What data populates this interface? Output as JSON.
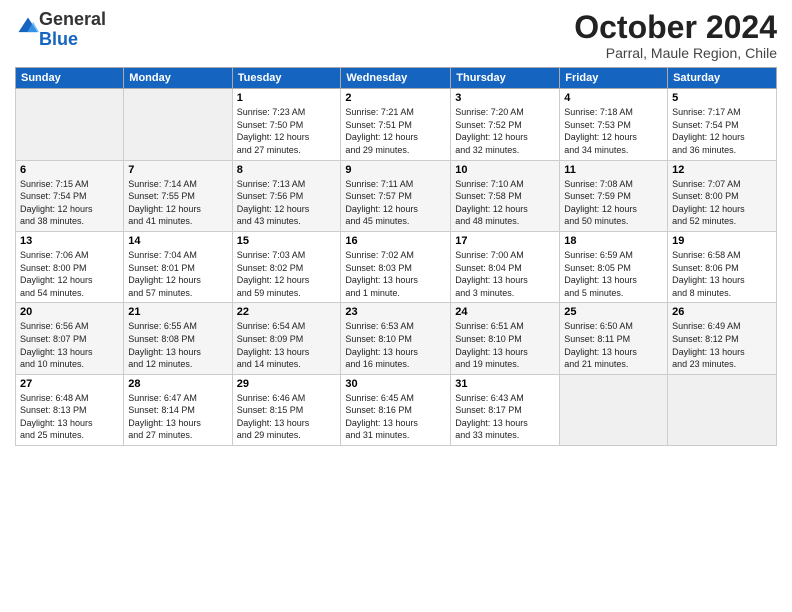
{
  "logo": {
    "general": "General",
    "blue": "Blue"
  },
  "header": {
    "month": "October 2024",
    "subtitle": "Parral, Maule Region, Chile"
  },
  "weekdays": [
    "Sunday",
    "Monday",
    "Tuesday",
    "Wednesday",
    "Thursday",
    "Friday",
    "Saturday"
  ],
  "weeks": [
    [
      {
        "day": "",
        "detail": ""
      },
      {
        "day": "",
        "detail": ""
      },
      {
        "day": "1",
        "detail": "Sunrise: 7:23 AM\nSunset: 7:50 PM\nDaylight: 12 hours\nand 27 minutes."
      },
      {
        "day": "2",
        "detail": "Sunrise: 7:21 AM\nSunset: 7:51 PM\nDaylight: 12 hours\nand 29 minutes."
      },
      {
        "day": "3",
        "detail": "Sunrise: 7:20 AM\nSunset: 7:52 PM\nDaylight: 12 hours\nand 32 minutes."
      },
      {
        "day": "4",
        "detail": "Sunrise: 7:18 AM\nSunset: 7:53 PM\nDaylight: 12 hours\nand 34 minutes."
      },
      {
        "day": "5",
        "detail": "Sunrise: 7:17 AM\nSunset: 7:54 PM\nDaylight: 12 hours\nand 36 minutes."
      }
    ],
    [
      {
        "day": "6",
        "detail": "Sunrise: 7:15 AM\nSunset: 7:54 PM\nDaylight: 12 hours\nand 38 minutes."
      },
      {
        "day": "7",
        "detail": "Sunrise: 7:14 AM\nSunset: 7:55 PM\nDaylight: 12 hours\nand 41 minutes."
      },
      {
        "day": "8",
        "detail": "Sunrise: 7:13 AM\nSunset: 7:56 PM\nDaylight: 12 hours\nand 43 minutes."
      },
      {
        "day": "9",
        "detail": "Sunrise: 7:11 AM\nSunset: 7:57 PM\nDaylight: 12 hours\nand 45 minutes."
      },
      {
        "day": "10",
        "detail": "Sunrise: 7:10 AM\nSunset: 7:58 PM\nDaylight: 12 hours\nand 48 minutes."
      },
      {
        "day": "11",
        "detail": "Sunrise: 7:08 AM\nSunset: 7:59 PM\nDaylight: 12 hours\nand 50 minutes."
      },
      {
        "day": "12",
        "detail": "Sunrise: 7:07 AM\nSunset: 8:00 PM\nDaylight: 12 hours\nand 52 minutes."
      }
    ],
    [
      {
        "day": "13",
        "detail": "Sunrise: 7:06 AM\nSunset: 8:00 PM\nDaylight: 12 hours\nand 54 minutes."
      },
      {
        "day": "14",
        "detail": "Sunrise: 7:04 AM\nSunset: 8:01 PM\nDaylight: 12 hours\nand 57 minutes."
      },
      {
        "day": "15",
        "detail": "Sunrise: 7:03 AM\nSunset: 8:02 PM\nDaylight: 12 hours\nand 59 minutes."
      },
      {
        "day": "16",
        "detail": "Sunrise: 7:02 AM\nSunset: 8:03 PM\nDaylight: 13 hours\nand 1 minute."
      },
      {
        "day": "17",
        "detail": "Sunrise: 7:00 AM\nSunset: 8:04 PM\nDaylight: 13 hours\nand 3 minutes."
      },
      {
        "day": "18",
        "detail": "Sunrise: 6:59 AM\nSunset: 8:05 PM\nDaylight: 13 hours\nand 5 minutes."
      },
      {
        "day": "19",
        "detail": "Sunrise: 6:58 AM\nSunset: 8:06 PM\nDaylight: 13 hours\nand 8 minutes."
      }
    ],
    [
      {
        "day": "20",
        "detail": "Sunrise: 6:56 AM\nSunset: 8:07 PM\nDaylight: 13 hours\nand 10 minutes."
      },
      {
        "day": "21",
        "detail": "Sunrise: 6:55 AM\nSunset: 8:08 PM\nDaylight: 13 hours\nand 12 minutes."
      },
      {
        "day": "22",
        "detail": "Sunrise: 6:54 AM\nSunset: 8:09 PM\nDaylight: 13 hours\nand 14 minutes."
      },
      {
        "day": "23",
        "detail": "Sunrise: 6:53 AM\nSunset: 8:10 PM\nDaylight: 13 hours\nand 16 minutes."
      },
      {
        "day": "24",
        "detail": "Sunrise: 6:51 AM\nSunset: 8:10 PM\nDaylight: 13 hours\nand 19 minutes."
      },
      {
        "day": "25",
        "detail": "Sunrise: 6:50 AM\nSunset: 8:11 PM\nDaylight: 13 hours\nand 21 minutes."
      },
      {
        "day": "26",
        "detail": "Sunrise: 6:49 AM\nSunset: 8:12 PM\nDaylight: 13 hours\nand 23 minutes."
      }
    ],
    [
      {
        "day": "27",
        "detail": "Sunrise: 6:48 AM\nSunset: 8:13 PM\nDaylight: 13 hours\nand 25 minutes."
      },
      {
        "day": "28",
        "detail": "Sunrise: 6:47 AM\nSunset: 8:14 PM\nDaylight: 13 hours\nand 27 minutes."
      },
      {
        "day": "29",
        "detail": "Sunrise: 6:46 AM\nSunset: 8:15 PM\nDaylight: 13 hours\nand 29 minutes."
      },
      {
        "day": "30",
        "detail": "Sunrise: 6:45 AM\nSunset: 8:16 PM\nDaylight: 13 hours\nand 31 minutes."
      },
      {
        "day": "31",
        "detail": "Sunrise: 6:43 AM\nSunset: 8:17 PM\nDaylight: 13 hours\nand 33 minutes."
      },
      {
        "day": "",
        "detail": ""
      },
      {
        "day": "",
        "detail": ""
      }
    ]
  ]
}
